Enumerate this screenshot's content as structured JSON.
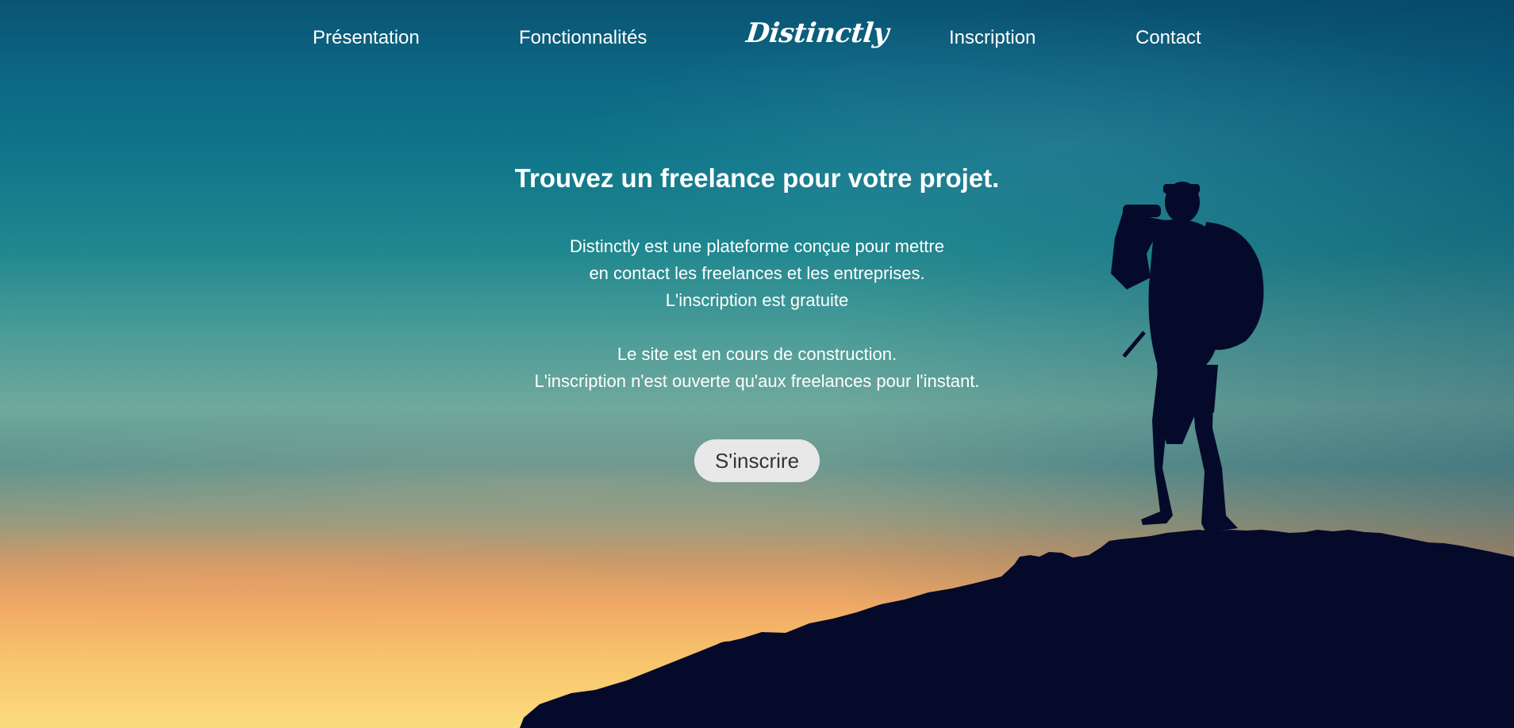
{
  "nav": {
    "presentation": "Présentation",
    "features": "Fonctionnalités",
    "logo": "Distinctly",
    "signup": "Inscription",
    "contact": "Contact"
  },
  "hero": {
    "headline": "Trouvez un freelance pour votre projet.",
    "lines": [
      "Distinctly est une plateforme conçue pour mettre",
      "en contact les freelances et les entreprises.",
      "L'inscription est gratuite",
      "Le site est en cours de construction.",
      "L'inscription n'est ouverte qu'aux freelances pour l'instant."
    ],
    "cta_label": "S'inscrire"
  },
  "colors": {
    "sky_top": "#0a5473",
    "sky_mid": "#6fa89c",
    "sunset": "#f7c56d",
    "silhouette": "#050a2a",
    "button_bg": "#e8e8e8",
    "button_text": "#333333"
  }
}
